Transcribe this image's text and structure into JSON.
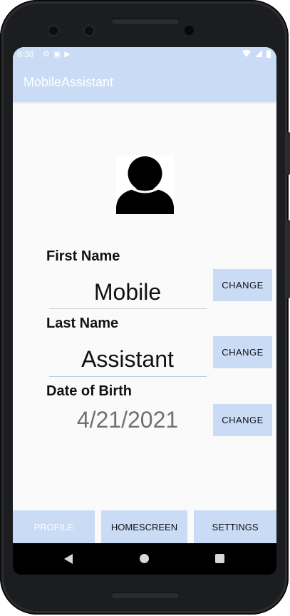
{
  "status_bar": {
    "time": "8:38",
    "left_icons": [
      "gear-icon",
      "image-icon",
      "play-store-icon"
    ],
    "right_icons": [
      "wifi-icon",
      "cellular-icon",
      "battery-icon"
    ]
  },
  "app_bar": {
    "title": "MobileAssistant"
  },
  "profile": {
    "first_name": {
      "label": "First Name",
      "value": "Mobile",
      "button": "CHANGE"
    },
    "last_name": {
      "label": "Last Name",
      "value": "Assistant",
      "button": "CHANGE"
    },
    "date_of_birth": {
      "label": "Date of Birth",
      "value": "4/21/2021",
      "button": "CHANGE"
    }
  },
  "bottom_tabs": {
    "profile": "PROFILE",
    "homescreen": "HOMESCREEN",
    "settings": "SETTINGS",
    "active": "profile"
  },
  "colors": {
    "accent": "#c9dbf5",
    "background": "#fafafa",
    "text": "#111111",
    "muted_text": "#707070"
  }
}
